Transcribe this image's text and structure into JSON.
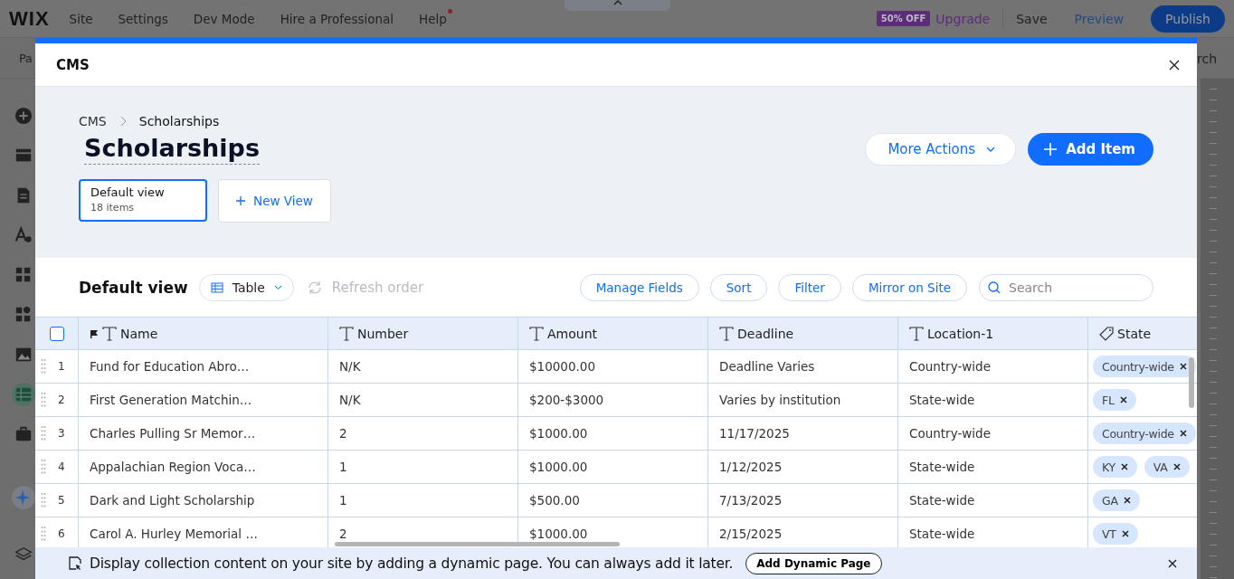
{
  "topbar": {
    "logo": "WIX",
    "menu": [
      {
        "label": "Site",
        "dot": false
      },
      {
        "label": "Settings",
        "dot": false
      },
      {
        "label": "Dev Mode",
        "dot": false
      },
      {
        "label": "Hire a Professional",
        "dot": false
      },
      {
        "label": "Help",
        "dot": true
      }
    ],
    "badge": "50% OFF",
    "upgrade": "Upgrade",
    "save": "Save",
    "preview": "Preview",
    "publish": "Publish"
  },
  "subbar": {
    "left": "Pa",
    "right": "rch"
  },
  "sidebar": [
    {
      "selected": false
    },
    {
      "selected": false
    },
    {
      "selected": false
    },
    {
      "selected": false
    },
    {
      "selected": false
    },
    {
      "selected": false
    },
    {
      "selected": false
    },
    {
      "selected": true
    },
    {
      "selected": false
    },
    {
      "selected": false
    },
    {
      "selected": false
    }
  ],
  "modal": {
    "title": "CMS",
    "breadcrumb": [
      "CMS",
      "Scholarships"
    ],
    "heading": "Scholarships",
    "more_actions": "More Actions",
    "add_item": "Add Item",
    "views": [
      {
        "name": "Default view",
        "count": "18 items",
        "selected": true
      }
    ],
    "new_view": "New View",
    "toolbar": {
      "title": "Default view",
      "layout": "Table",
      "refresh": "Refresh order",
      "refresh_disabled": true,
      "buttons": [
        "Manage Fields",
        "Sort",
        "Filter",
        "Mirror on Site"
      ],
      "search_placeholder": "Search"
    },
    "table": {
      "all_checked": false,
      "columns": [
        {
          "label": "Name",
          "kind": "text",
          "primary": true
        },
        {
          "label": "Number",
          "kind": "text",
          "primary": false
        },
        {
          "label": "Amount",
          "kind": "text",
          "primary": false
        },
        {
          "label": "Deadline",
          "kind": "text",
          "primary": false
        },
        {
          "label": "Location-1",
          "kind": "text",
          "primary": false
        },
        {
          "label": "State",
          "kind": "tags",
          "primary": false
        }
      ],
      "rows": [
        {
          "index": "1",
          "cells": [
            "Fund for Education Abro…",
            "N/K",
            "$10000.00",
            "Deadline Varies",
            "Country-wide"
          ],
          "tags": [
            "Country-wide"
          ]
        },
        {
          "index": "2",
          "cells": [
            "First Generation Matchin…",
            "N/K",
            "$200-$3000",
            "Varies by institution",
            "State-wide"
          ],
          "tags": [
            "FL"
          ]
        },
        {
          "index": "3",
          "cells": [
            "Charles Pulling Sr Memor…",
            "2",
            "$1000.00",
            "11/17/2025",
            "Country-wide"
          ],
          "tags": [
            "Country-wide"
          ]
        },
        {
          "index": "4",
          "cells": [
            "Appalachian Region Voca…",
            "1",
            "$1000.00",
            "1/12/2025",
            "State-wide"
          ],
          "tags": [
            "KY",
            "VA"
          ]
        },
        {
          "index": "5",
          "cells": [
            "Dark and Light Scholarship",
            "1",
            "$500.00",
            "7/13/2025",
            "State-wide"
          ],
          "tags": [
            "GA"
          ]
        },
        {
          "index": "6",
          "cells": [
            "Carol A. Hurley Memorial …",
            "2",
            "$1000.00",
            "2/15/2025",
            "State-wide"
          ],
          "tags": [
            "VT"
          ]
        }
      ]
    },
    "banner": {
      "text": "Display collection content on your site by adding a dynamic page. You can always add it later.",
      "button": "Add Dynamic Page"
    }
  }
}
